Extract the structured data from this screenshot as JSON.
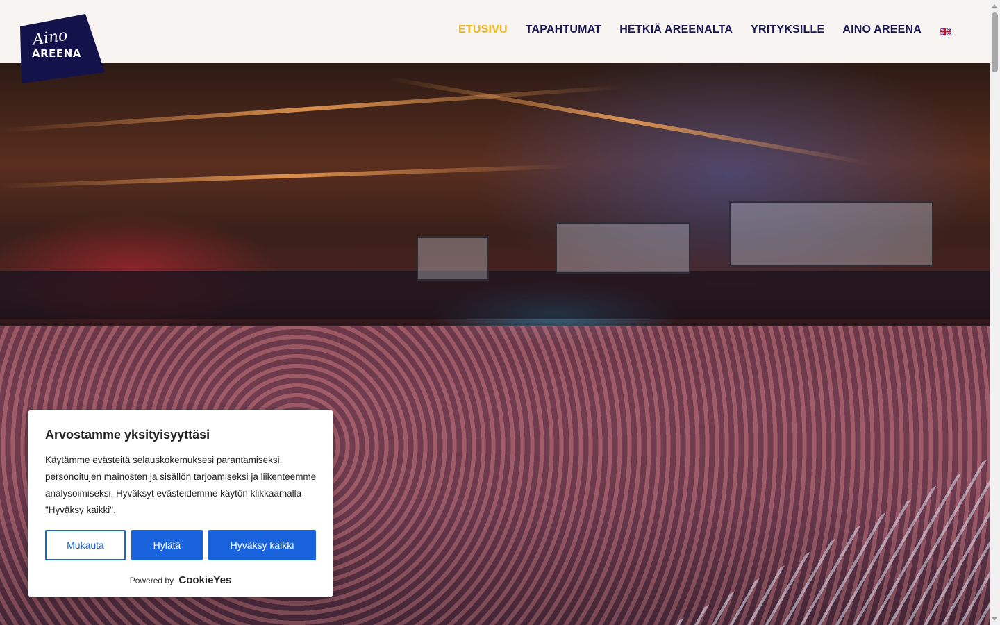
{
  "header": {
    "logo_script": "Aino",
    "logo_word": "AREENA",
    "logo_color": "#14124a"
  },
  "nav": {
    "items": [
      {
        "label": "ETUSIVU",
        "active": true
      },
      {
        "label": "TAPAHTUMAT",
        "active": false
      },
      {
        "label": "HETKIÄ AREENALTA",
        "active": false
      },
      {
        "label": "YRITYKSILLE",
        "active": false
      },
      {
        "label": "AINO AREENA",
        "active": false
      }
    ],
    "language_icon": "uk-flag-icon",
    "active_color": "#f1b51c",
    "text_color": "#1a1752"
  },
  "hero": {
    "image_subject": "crowd-concert-photo"
  },
  "cookie_banner": {
    "title": "Arvostamme yksityisyyttäsi",
    "body": "Käytämme evästeitä selauskokemuksesi parantamiseksi, personoitujen mainosten ja sisällön tarjoamiseksi ja liikenteemme analysoimiseksi. Hyväksyt evästeidemme käytön klikkaamalla \"Hyväksy kaikki\".",
    "buttons": {
      "customize": "Mukauta",
      "reject": "Hylätä",
      "accept": "Hyväksy kaikki"
    },
    "powered_by": "Powered by",
    "powered_brand": "CookieYes",
    "accent_color": "#1863dc"
  }
}
